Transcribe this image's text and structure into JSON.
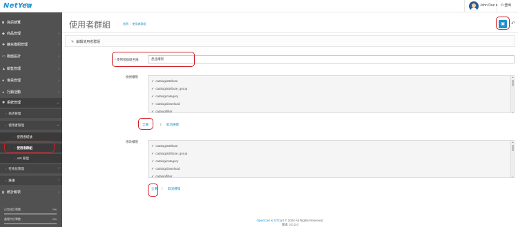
{
  "brand": {
    "logo_text": "NetYea"
  },
  "user": {
    "name": "John Doe ▾",
    "logout_label": "登出"
  },
  "sidebar": {
    "items": [
      {
        "icon": "dashboard-icon",
        "glyph": "◙",
        "label": "資訊總覽",
        "has_children": false
      },
      {
        "icon": "tag-icon",
        "glyph": "◆",
        "label": "商品管理",
        "has_children": true
      },
      {
        "icon": "puzzle-icon",
        "glyph": "✚",
        "label": "擴充模組管理",
        "has_children": true
      },
      {
        "icon": "monitor-icon",
        "glyph": "▭",
        "label": "版面設計",
        "has_children": true
      },
      {
        "icon": "cart-icon",
        "glyph": "▲",
        "label": "銷售管理",
        "has_children": true
      },
      {
        "icon": "user-icon",
        "glyph": "●",
        "label": "會員管理",
        "has_children": true
      },
      {
        "icon": "share-icon",
        "glyph": "◂",
        "label": "行銷活動",
        "has_children": true
      },
      {
        "icon": "gear-icon",
        "glyph": "✱",
        "label": "系統管理",
        "has_children": true,
        "active": true
      }
    ],
    "sub_items": [
      {
        "label": "商店管理",
        "level": 1,
        "has_children": false
      },
      {
        "label": "使用者管理",
        "level": 1,
        "has_children": true
      },
      {
        "label": "使用者帳號",
        "level": 2,
        "has_children": false
      },
      {
        "label": "使用者群組",
        "level": 2,
        "has_children": false,
        "selected": true
      },
      {
        "label": "API 管理",
        "level": 2,
        "has_children": false
      },
      {
        "label": "在地化管理",
        "level": 1,
        "has_children": true
      },
      {
        "label": "維護",
        "level": 1,
        "has_children": true
      }
    ],
    "reports": {
      "icon": "chart-icon",
      "glyph": "▮",
      "label": "統計報表"
    },
    "stats": [
      {
        "label": "已完成訂單數",
        "percent_text": "0%",
        "percent": 0
      },
      {
        "label": "處理中訂單數",
        "percent_text": "0%",
        "percent": 0
      }
    ]
  },
  "header": {
    "title": "使用者群組",
    "breadcrumb": [
      "首頁",
      "使用者群組"
    ],
    "save_tooltip": "儲存",
    "back_tooltip": "返回"
  },
  "panel": {
    "title": "編輯使用者群組",
    "group_name_label": "使用者群組名稱",
    "group_name_value": "產品權限",
    "access_label": "檢視權限",
    "modify_label": "修改權限",
    "access_permissions": [
      "catalog/attribute",
      "catalog/attribute_group",
      "catalog/category",
      "catalog/download",
      "catalog/filter"
    ],
    "modify_permissions": [
      "catalog/attribute",
      "catalog/attribute_group",
      "catalog/category",
      "catalog/download",
      "catalog/filter"
    ],
    "select_all_label": "全選",
    "unselect_all_label": "取消選擇",
    "separator": "/"
  },
  "footer": {
    "line1_prefix": "OpenCart & NTCart",
    "line1_suffix": " © 2024 All Rights Reserved.",
    "line2": "版本 3.0.2.0"
  },
  "colors": {
    "accent": "#1e91cf",
    "sidebar_bg": "#515151",
    "highlight": "#d21c24"
  }
}
